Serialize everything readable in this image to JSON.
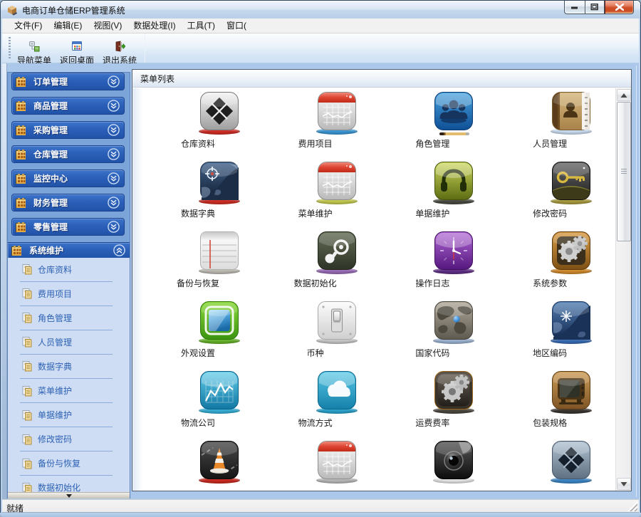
{
  "window": {
    "title": "电商订单仓储ERP管理系统",
    "app_icon": "box-cube-icon",
    "controls": {
      "minimize": "minimize-button",
      "maximize": "maximize-button",
      "close": "close-button"
    }
  },
  "menu_bar": {
    "items": [
      {
        "label": "文件(F)"
      },
      {
        "label": "编辑(E)"
      },
      {
        "label": "视图(V)"
      },
      {
        "label": "数据处理(I)"
      },
      {
        "label": "工具(T)"
      },
      {
        "label": "窗口("
      }
    ]
  },
  "toolbar": {
    "buttons": [
      {
        "label": "导航菜单",
        "icon": "nav-menu-icon"
      },
      {
        "label": "返回桌面",
        "icon": "return-desktop-icon"
      },
      {
        "label": "退出系统",
        "icon": "exit-system-icon"
      }
    ]
  },
  "sidebar": {
    "groups": [
      {
        "label": "订单管理",
        "expanded": false
      },
      {
        "label": "商品管理",
        "expanded": false
      },
      {
        "label": "采购管理",
        "expanded": false
      },
      {
        "label": "仓库管理",
        "expanded": false
      },
      {
        "label": "监控中心",
        "expanded": false
      },
      {
        "label": "财务管理",
        "expanded": false
      },
      {
        "label": "零售管理",
        "expanded": false
      },
      {
        "label": "系统维护",
        "expanded": true
      }
    ],
    "expanded_items": [
      {
        "label": "仓库资料"
      },
      {
        "label": "费用项目"
      },
      {
        "label": "角色管理"
      },
      {
        "label": "人员管理"
      },
      {
        "label": "数据字典"
      },
      {
        "label": "菜单维护"
      },
      {
        "label": "单据维护"
      },
      {
        "label": "修改密码"
      },
      {
        "label": "备份与恢复"
      },
      {
        "label": "数据初始化"
      }
    ],
    "scroll_indicator": "scroll-down-triangle"
  },
  "main_panel": {
    "header": "菜单列表",
    "icons": [
      {
        "label": "仓库资料",
        "icon": "diamond-x-dark",
        "base": "#cf2d24"
      },
      {
        "label": "费用项目",
        "icon": "calendar-chart",
        "base": "#3a97d4"
      },
      {
        "label": "角色管理",
        "icon": "people-group",
        "base": "pencil"
      },
      {
        "label": "人员管理",
        "icon": "address-book",
        "base": "#cadcf0"
      },
      {
        "label": "数据字典",
        "icon": "map-dark",
        "base": "#cf2d24"
      },
      {
        "label": "菜单维护",
        "icon": "calendar-chart",
        "base": "#c3c94e"
      },
      {
        "label": "单据维护",
        "icon": "headphones",
        "base": "#4a4a42"
      },
      {
        "label": "修改密码",
        "icon": "key-dark",
        "base": "#a89b3e"
      },
      {
        "label": "备份与恢复",
        "icon": "notebook",
        "base": "#bdbab2"
      },
      {
        "label": "数据初始化",
        "icon": "steam-logo",
        "base": "#9a6cb8"
      },
      {
        "label": "操作日志",
        "icon": "clock-purple",
        "base": "#5f2f86"
      },
      {
        "label": "系统参数",
        "icon": "gears-bronze",
        "base": "#d08a2c"
      },
      {
        "label": "外观设置",
        "icon": "green-display",
        "base": "#66b32a"
      },
      {
        "label": "币种",
        "icon": "light-switch",
        "base": "#c6c6c6"
      },
      {
        "label": "国家代码",
        "icon": "world-map",
        "base": "#9ab2d0"
      },
      {
        "label": "地区编码",
        "icon": "map-star-blue",
        "base": "#3a6cb4"
      },
      {
        "label": "物流公司",
        "icon": "chart-teal",
        "base": "#35aed6"
      },
      {
        "label": "物流方式",
        "icon": "cloud-teal",
        "base": "#2aa2cb"
      },
      {
        "label": "运费费率",
        "icon": "gears-dark",
        "base": "#4c4840"
      },
      {
        "label": "包装规格",
        "icon": "tv-retro",
        "base": "#3a3530"
      },
      {
        "label": "",
        "icon": "vlc-cone",
        "base": "#cb2a20"
      },
      {
        "label": "",
        "icon": "calendar-chart",
        "base": "#b8b8b8"
      },
      {
        "label": "",
        "icon": "camera-lens",
        "base": "#e4e4e4"
      },
      {
        "label": "",
        "icon": "diamond-x-slate",
        "base": "#3c86c6"
      }
    ]
  },
  "scrollbar": {
    "orientation": "vertical"
  },
  "status_bar": {
    "text": "就绪"
  }
}
